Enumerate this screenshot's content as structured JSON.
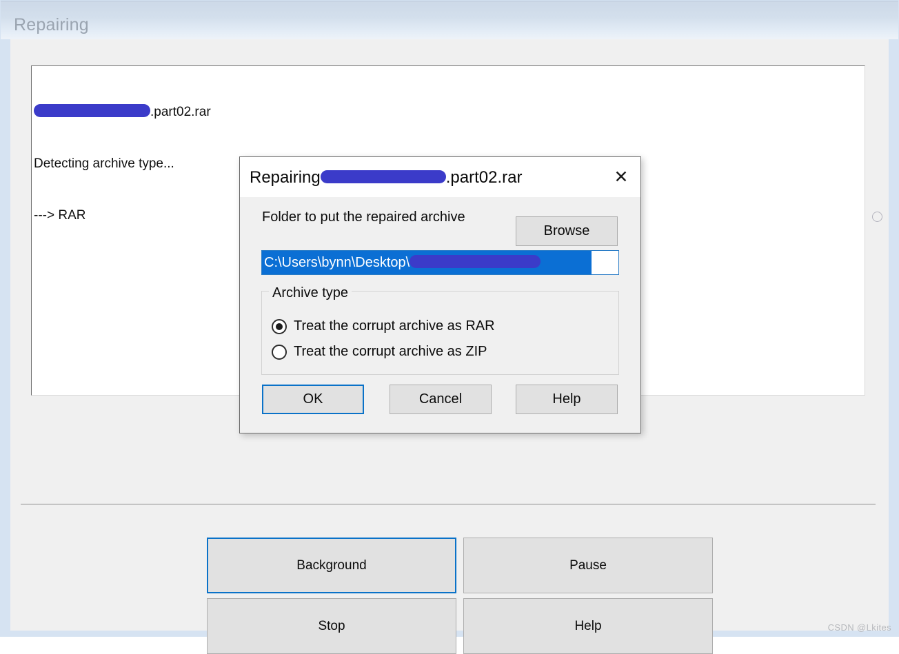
{
  "window": {
    "title": "Repairing"
  },
  "log": {
    "lines": [
      {
        "redacted": true,
        "text": ".part02.rar"
      },
      {
        "redacted": false,
        "text": "Detecting archive type..."
      },
      {
        "redacted": false,
        "text": "---> RAR"
      }
    ],
    "line1_suffix": ".part02.rar",
    "line2": "Detecting archive type...",
    "line3": "---> RAR"
  },
  "main_buttons": {
    "background": "Background",
    "pause": "Pause",
    "stop": "Stop",
    "help": "Help"
  },
  "dialog": {
    "title_prefix": "Repairing",
    "title_suffix": ".part02.rar",
    "close_icon": "close-icon",
    "folder_label": "Folder to put the repaired archive",
    "browse_label": "Browse",
    "path_value": "C:\\Users\\bynn\\Desktop\\",
    "archive_type": {
      "legend": "Archive type",
      "options": [
        {
          "label": "Treat the corrupt archive as RAR",
          "selected": true
        },
        {
          "label": "Treat the corrupt archive as ZIP",
          "selected": false
        }
      ]
    },
    "buttons": {
      "ok": "OK",
      "cancel": "Cancel",
      "help": "Help"
    }
  },
  "watermark": "CSDN @Lkites",
  "colors": {
    "redaction_blue": "#3b3bc9",
    "selection_blue": "#0b6fd4",
    "focus_border": "#0a72c8",
    "title_bar_text": "#9aa4b0",
    "window_border": "#d6e3f2"
  }
}
